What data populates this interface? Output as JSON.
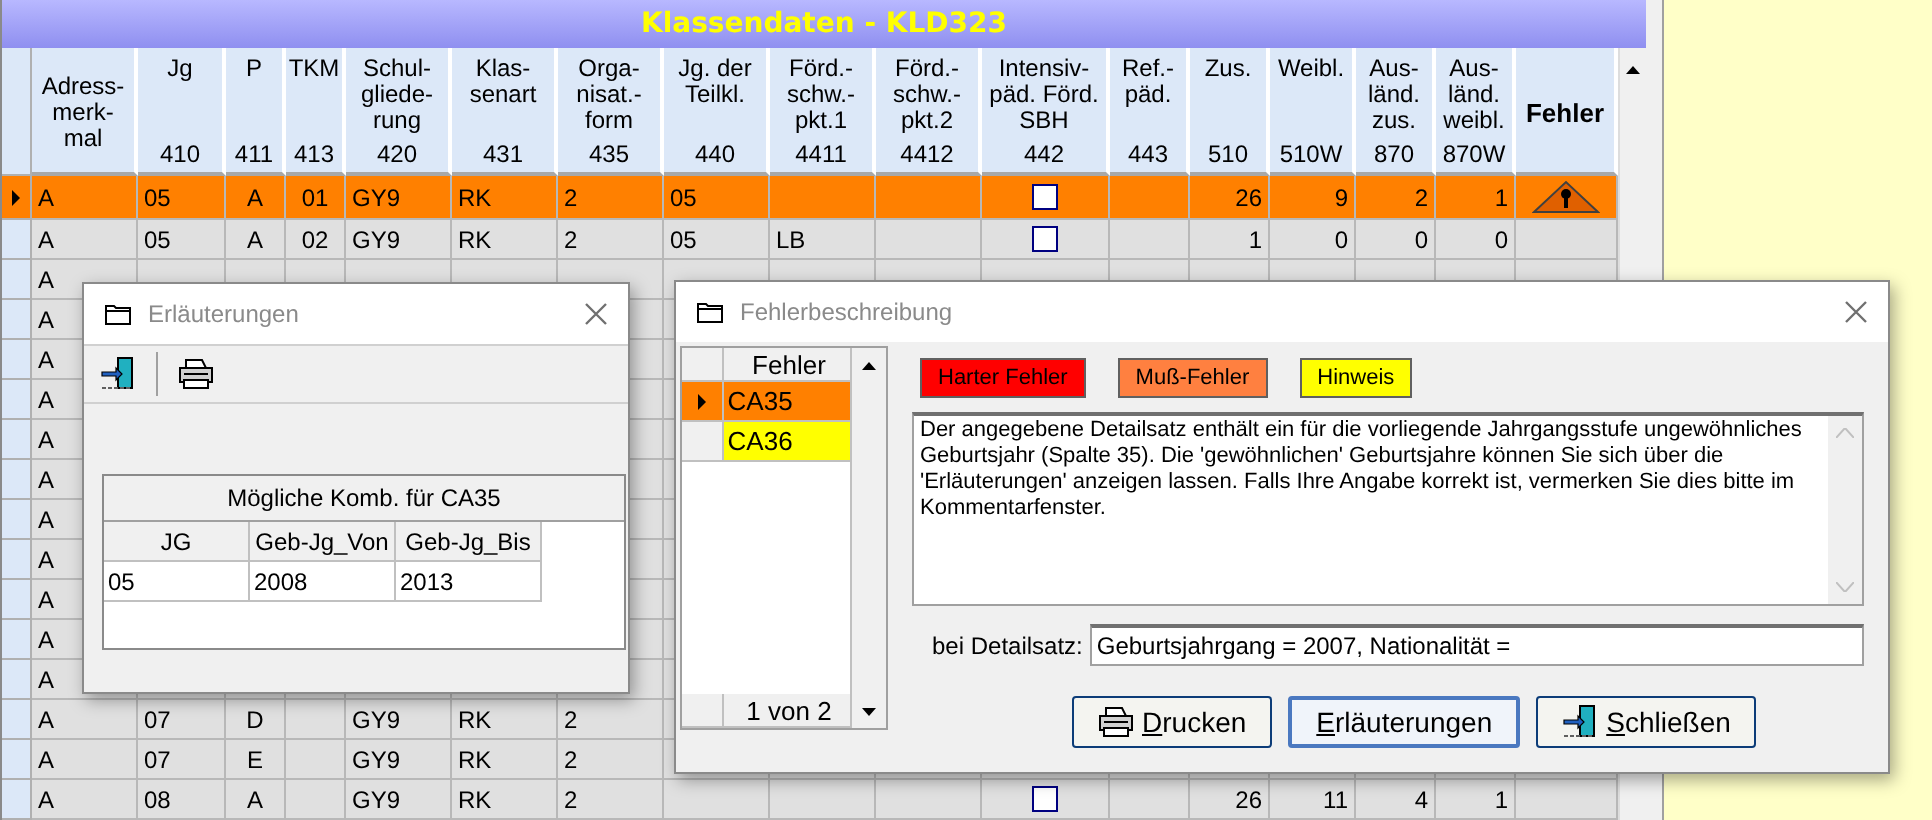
{
  "window": {
    "title": "Klassendaten - KLD323"
  },
  "table": {
    "columns": [
      {
        "kind": "text",
        "label": "Adress-\nmerk-\nmal"
      },
      {
        "kind": "text",
        "label": "Jg",
        "code": "410"
      },
      {
        "kind": "code",
        "label": "P",
        "code": "411"
      },
      {
        "kind": "code",
        "label": "TKM",
        "code": "413"
      },
      {
        "kind": "text",
        "label": "Schul-\ngliede-\nrung",
        "code": "420"
      },
      {
        "kind": "text",
        "label": "Klas-\nsenart",
        "code": "431"
      },
      {
        "kind": "text",
        "label": "Orga-\nnisat.-\nform",
        "code": "435"
      },
      {
        "kind": "text",
        "label": "Jg. der\nTeilkl.",
        "code": "440"
      },
      {
        "kind": "text",
        "label": "Förd.-\nschw.-\npkt.1",
        "code": "4411"
      },
      {
        "kind": "text",
        "label": "Förd.-\nschw.-\npkt.2",
        "code": "4412"
      },
      {
        "kind": "checkbox",
        "label": "Intensiv-\npäd. Förd.\nSBH",
        "code": "442"
      },
      {
        "kind": "text",
        "label": "Ref.-\npäd.",
        "code": "443"
      },
      {
        "kind": "number",
        "label": "Zus.",
        "code": "510"
      },
      {
        "kind": "number",
        "label": "Weibl.",
        "code": "510W"
      },
      {
        "kind": "number",
        "label": "Aus-\nländ.\nzus.",
        "code": "870"
      },
      {
        "kind": "number",
        "label": "Aus-\nländ.\nweibl.",
        "code": "870W"
      },
      {
        "kind": "error",
        "label": "Fehler"
      }
    ],
    "rows": [
      {
        "selected": true,
        "cells": [
          "A",
          "05",
          "A",
          "01",
          "GY9",
          "RK",
          "2",
          "05",
          null,
          null,
          false,
          null,
          "26",
          "9",
          "2",
          "1",
          true
        ]
      },
      {
        "selected": false,
        "cells": [
          "A",
          "05",
          "A",
          "02",
          "GY9",
          "RK",
          "2",
          "05",
          "LB",
          null,
          false,
          null,
          "1",
          "0",
          "0",
          "0",
          false
        ]
      },
      {
        "selected": false,
        "cells": [
          "A",
          null,
          null,
          null,
          null,
          null,
          null,
          null,
          null,
          null,
          null,
          null,
          null,
          null,
          null,
          null,
          null
        ]
      },
      {
        "selected": false,
        "cells": [
          "A",
          null,
          null,
          null,
          null,
          null,
          null,
          null,
          null,
          null,
          null,
          null,
          null,
          null,
          null,
          null,
          null
        ]
      },
      {
        "selected": false,
        "cells": [
          "A",
          null,
          null,
          null,
          null,
          null,
          null,
          null,
          null,
          null,
          null,
          null,
          null,
          null,
          null,
          null,
          null
        ]
      },
      {
        "selected": false,
        "cells": [
          "A",
          null,
          null,
          null,
          null,
          null,
          null,
          null,
          null,
          null,
          null,
          null,
          null,
          null,
          null,
          null,
          null
        ]
      },
      {
        "selected": false,
        "cells": [
          "A",
          null,
          null,
          null,
          null,
          null,
          null,
          null,
          null,
          null,
          null,
          null,
          null,
          null,
          null,
          null,
          null
        ]
      },
      {
        "selected": false,
        "cells": [
          "A",
          null,
          null,
          null,
          null,
          null,
          null,
          null,
          null,
          null,
          null,
          null,
          null,
          null,
          null,
          null,
          null
        ]
      },
      {
        "selected": false,
        "cells": [
          "A",
          null,
          null,
          null,
          null,
          null,
          null,
          null,
          null,
          null,
          null,
          null,
          null,
          null,
          null,
          null,
          null
        ]
      },
      {
        "selected": false,
        "cells": [
          "A",
          null,
          null,
          null,
          null,
          null,
          null,
          null,
          null,
          null,
          null,
          null,
          null,
          null,
          null,
          null,
          null
        ]
      },
      {
        "selected": false,
        "cells": [
          "A",
          null,
          null,
          null,
          null,
          null,
          null,
          null,
          null,
          null,
          null,
          null,
          null,
          null,
          null,
          null,
          null
        ]
      },
      {
        "selected": false,
        "cells": [
          "A",
          null,
          null,
          null,
          null,
          null,
          null,
          null,
          null,
          null,
          null,
          null,
          null,
          null,
          null,
          null,
          null
        ]
      },
      {
        "selected": false,
        "cells": [
          "A",
          null,
          null,
          null,
          null,
          null,
          null,
          null,
          null,
          null,
          null,
          null,
          null,
          null,
          null,
          null,
          null
        ]
      },
      {
        "selected": false,
        "cells": [
          "A",
          "07",
          "D",
          null,
          "GY9",
          "RK",
          "2",
          null,
          null,
          null,
          null,
          null,
          null,
          null,
          null,
          null,
          null
        ]
      },
      {
        "selected": false,
        "cells": [
          "A",
          "07",
          "E",
          null,
          "GY9",
          "RK",
          "2",
          null,
          null,
          null,
          null,
          null,
          null,
          null,
          null,
          null,
          null
        ]
      },
      {
        "selected": false,
        "cells": [
          "A",
          "08",
          "A",
          null,
          "GY9",
          "RK",
          "2",
          null,
          null,
          null,
          false,
          null,
          "26",
          "11",
          "4",
          "1",
          false
        ]
      }
    ]
  },
  "explanation_dialog": {
    "title": "Erläuterungen",
    "caption": "Mögliche Komb. für CA35",
    "columns": [
      "JG",
      "Geb-Jg_Von",
      "Geb-Jg_Bis"
    ],
    "rows": [
      [
        "05",
        "2008",
        "2013"
      ]
    ]
  },
  "error_dialog": {
    "title": "Fehlerbeschreibung",
    "list_header": "Fehler",
    "errors": [
      {
        "code": "CA35",
        "color": "#ff8000",
        "selected": true
      },
      {
        "code": "CA36",
        "color": "#ffff00",
        "selected": false
      }
    ],
    "pager": "1 von 2",
    "legend": [
      {
        "label": "Harter Fehler",
        "color": "#ff0000"
      },
      {
        "label": "Muß-Fehler",
        "color": "#ff8040"
      },
      {
        "label": "Hinweis",
        "color": "#ffff00"
      }
    ],
    "description": "Der angegebene Detailsatz enthält ein für die vorliegende Jahrgangsstufe ungewöhnliches Geburtsjahr (Spalte 35). Die 'gewöhnlichen' Geburtsjahre können Sie sich über die 'Erläuterungen' anzeigen lassen. Falls Ihre Angabe korrekt ist, vermerken Sie dies bitte im Kommentarfenster.",
    "detail_label": "bei Detailsatz:",
    "detail_value": "Geburtsjahrgang = 2007, Nationalität =",
    "buttons": [
      {
        "kind": "print",
        "label": "Drucken",
        "default": false
      },
      {
        "kind": "plain",
        "label": "Erläuterungen",
        "default": true
      },
      {
        "kind": "exit",
        "label": "Schließen",
        "default": false
      }
    ]
  }
}
